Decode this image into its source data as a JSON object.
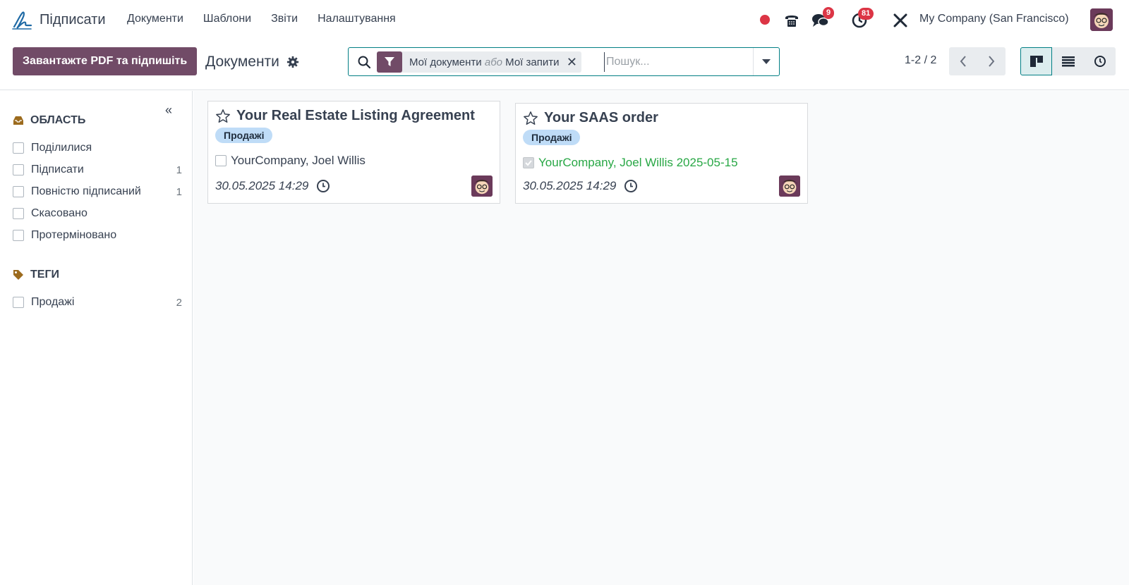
{
  "app": {
    "name": "Підписати",
    "menu": [
      "Документи",
      "Шаблони",
      "Звіти",
      "Налаштування"
    ]
  },
  "systray": {
    "messages_count": "9",
    "activities_count": "81",
    "company": "My Company (San Francisco)"
  },
  "control": {
    "upload_button": "Завантажте PDF та підпишіть",
    "breadcrumb": "Документи",
    "search": {
      "facet_part1": "Мої документи",
      "facet_or": "або",
      "facet_part2": "Мої запити",
      "placeholder": "Пошук..."
    },
    "pager": "1-2 / 2"
  },
  "sidebar": {
    "section_area": "ОБЛАСТЬ",
    "area_items": [
      {
        "label": "Поділилися",
        "count": ""
      },
      {
        "label": "Підписати",
        "count": "1"
      },
      {
        "label": "Повністю підписаний",
        "count": "1"
      },
      {
        "label": "Скасовано",
        "count": ""
      },
      {
        "label": "Протерміновано",
        "count": ""
      }
    ],
    "section_tags": "ТЕГИ",
    "tag_items": [
      {
        "label": "Продажі",
        "count": "2"
      }
    ]
  },
  "cards": [
    {
      "title": "Your Real Estate Listing Agreement",
      "tag": "Продажі",
      "signers": "YourCompany, Joel Willis",
      "date": "30.05.2025 14:29"
    },
    {
      "title": "Your SAAS order",
      "tag": "Продажі",
      "signers": "YourCompany, Joel Willis 2025-05-15",
      "date": "30.05.2025 14:29"
    }
  ],
  "colors": {
    "primary": "#714b67",
    "accent": "#017e84",
    "badge": "#dc3545",
    "tag_bg": "#bfdcf7",
    "signed_text": "#28a745"
  }
}
